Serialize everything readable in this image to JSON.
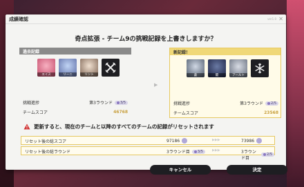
{
  "dialog": {
    "title": "成績確認",
    "version": "ver1.0",
    "close": "✕",
    "question": "奇点拡張 - チーム9の挑戦記録を上書きしますか？"
  },
  "old_record": {
    "header": "過去記録",
    "characters": [
      "エイス",
      "リーニ",
      "リント"
    ],
    "progress_label": "挑戦進捗",
    "progress_round": "第3ラウンド",
    "progress_count": "3/5",
    "score_label": "チームスコア",
    "score": "46768"
  },
  "new_record": {
    "header": "新記録！",
    "characters": [
      "蒼",
      "闘",
      "アールト"
    ],
    "progress_label": "挑戦進捗",
    "progress_round": "第3ラウンド",
    "progress_count": "2/5",
    "score_label": "チームスコア",
    "score": "23568"
  },
  "warning": {
    "text": "更新すると、現在のチームと以降のすべてのチームの記録がリセットされます"
  },
  "reset": {
    "total_score": {
      "label": "リセット後の総スコア",
      "old": "97186",
      "new": "73986"
    },
    "total_round": {
      "label": "リセット後の総ラウンド",
      "old_round": "3ラウンド目",
      "old_count": "3/5",
      "new_round": "3ラウンド目",
      "new_count": "2/5"
    }
  },
  "buttons": {
    "cancel": "キャンセル",
    "confirm": "決定"
  },
  "colors": {
    "accent_gold": "#e6c860",
    "button_dark": "#1e1e22",
    "warning_red": "#d03030"
  }
}
